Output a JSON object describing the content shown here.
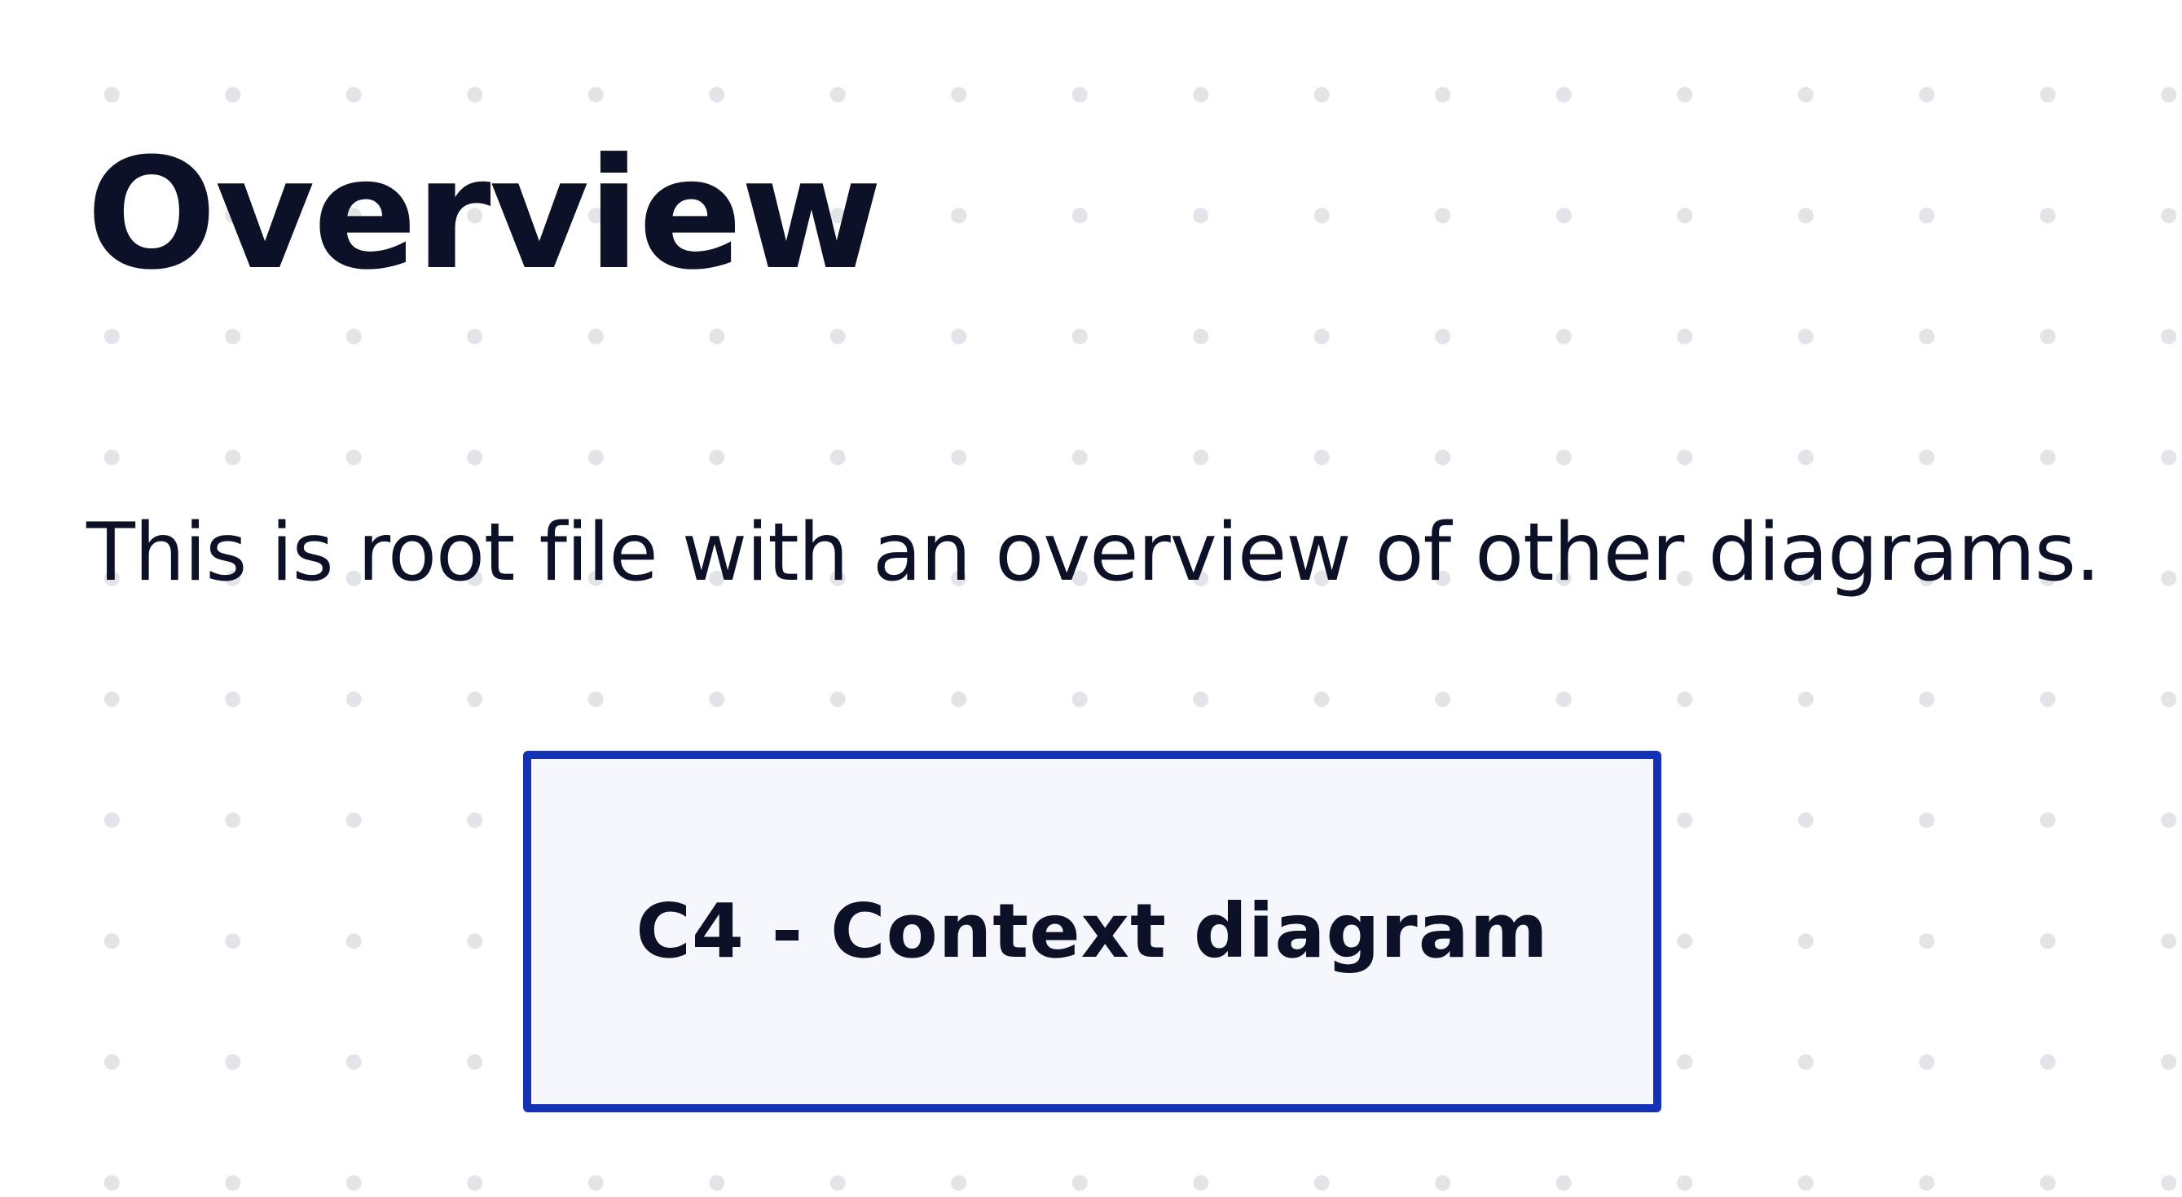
{
  "page": {
    "title": "Overview",
    "description": "This is root file with an overview of other diagrams."
  },
  "diagram_links": [
    {
      "label": "C4 - Context diagram"
    }
  ],
  "colors": {
    "text": "#0d1127",
    "link_border": "#1432b4",
    "link_fill": "#f5f7fc",
    "grid_dot": "#e3e4e7",
    "background": "#ffffff"
  }
}
